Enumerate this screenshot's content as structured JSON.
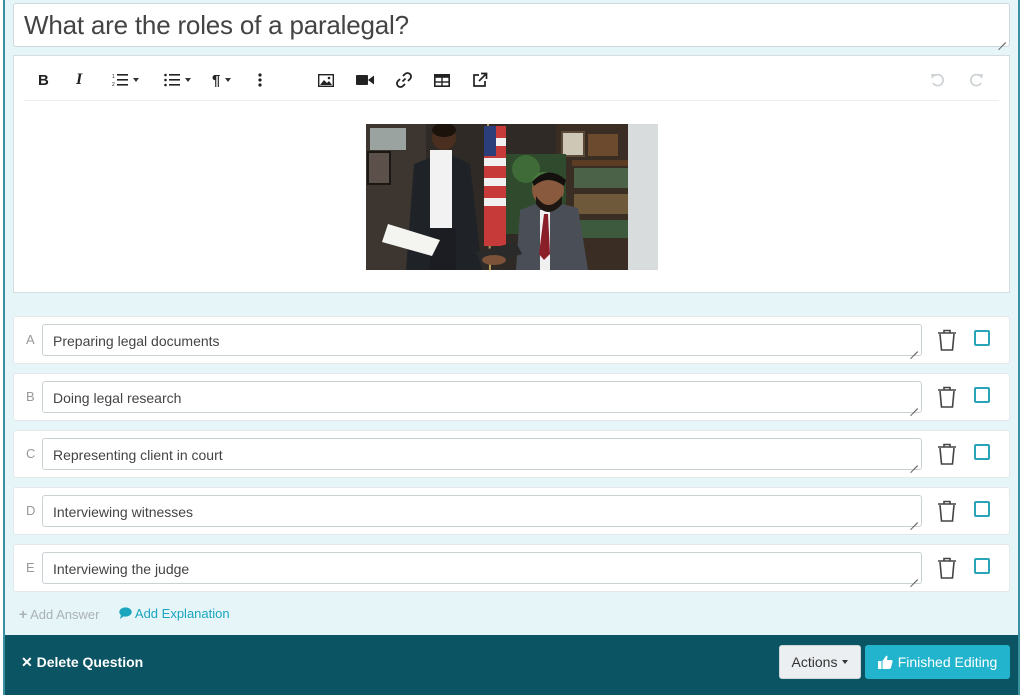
{
  "question": {
    "text": "What are the roles of a paralegal?"
  },
  "toolbar": {
    "bold": "B",
    "italic": "I",
    "paragraph": "¶"
  },
  "answers": [
    {
      "letter": "A",
      "text": "Preparing legal documents"
    },
    {
      "letter": "B",
      "text": "Doing legal research"
    },
    {
      "letter": "C",
      "text": "Representing client in court"
    },
    {
      "letter": "D",
      "text": "Interviewing witnesses"
    },
    {
      "letter": "E",
      "text": "Interviewing the judge"
    }
  ],
  "links": {
    "add_answer": "Add Answer",
    "add_explanation": "Add Explanation"
  },
  "footer": {
    "delete_label": "Delete Question",
    "actions_label": "Actions",
    "finished_label": "Finished Editing"
  },
  "colors": {
    "accent": "#22b4cd",
    "footer_bg": "#0b5463",
    "panel_bg": "#e6f5f8"
  }
}
